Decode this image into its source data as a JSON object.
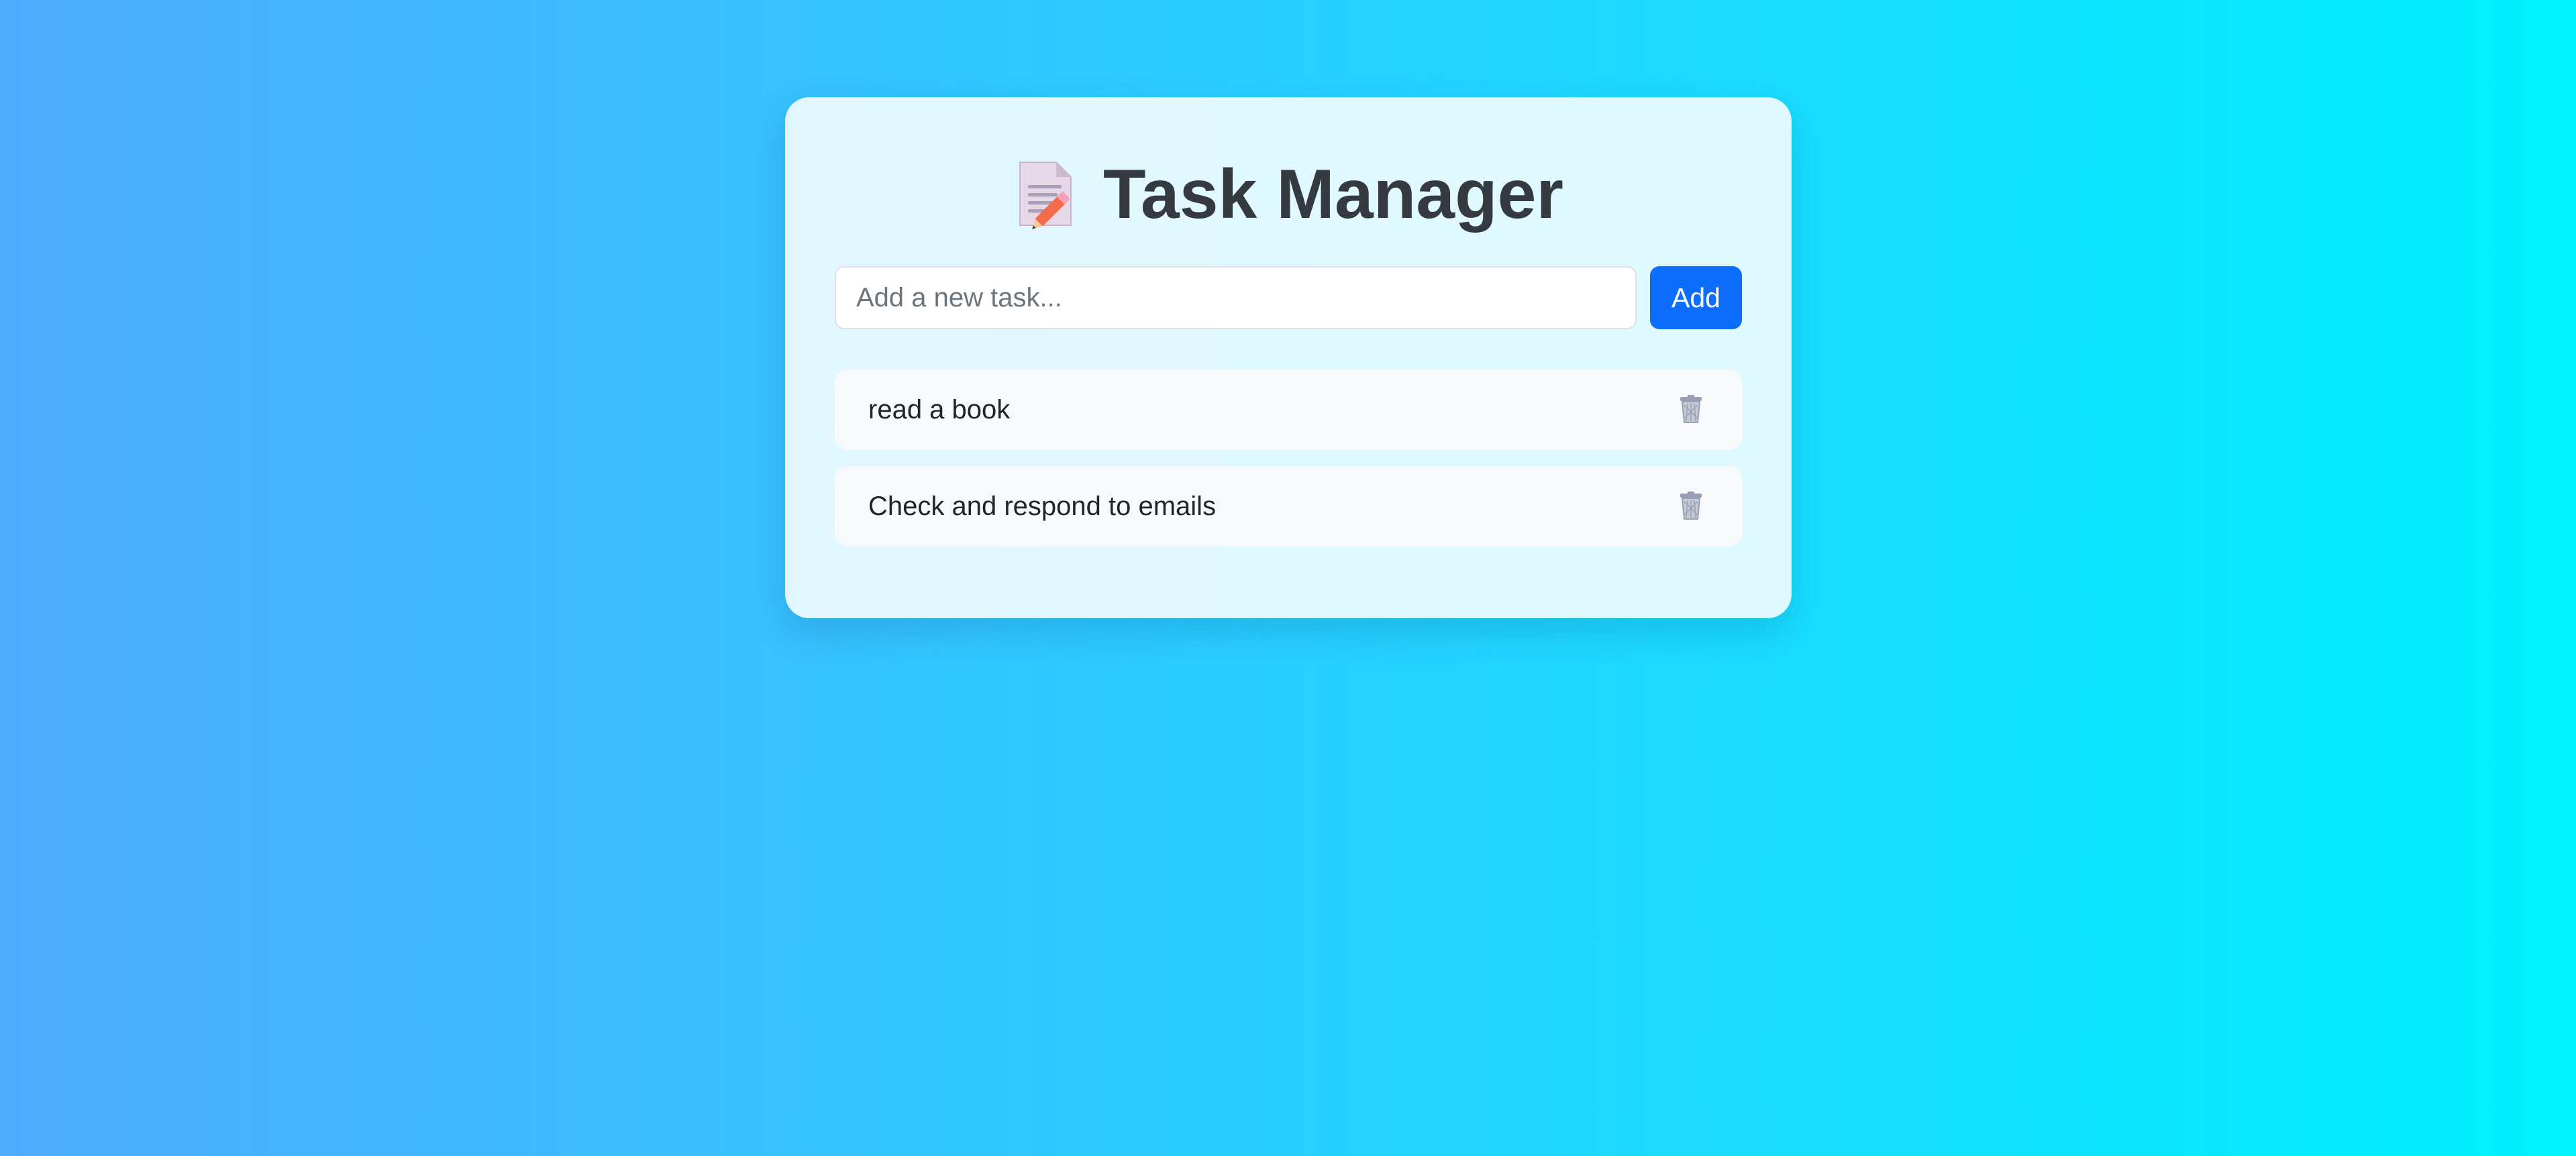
{
  "app": {
    "title": "Task Manager",
    "title_icon": "memo-pencil-icon"
  },
  "new_task": {
    "placeholder": "Add a new task...",
    "value": "",
    "add_label": "Add"
  },
  "tasks": [
    {
      "text": "read a book",
      "delete_icon": "trash-icon"
    },
    {
      "text": "Check and respond to emails",
      "delete_icon": "trash-icon"
    }
  ],
  "colors": {
    "background_start": "#4facfe",
    "background_end": "#00f2fe",
    "accent": "#0d6efd",
    "title_text": "#343a40"
  }
}
